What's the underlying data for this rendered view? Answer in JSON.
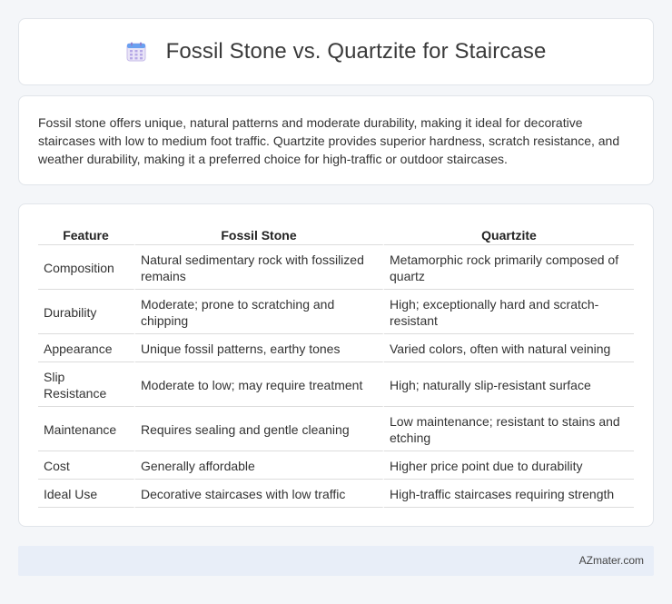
{
  "header": {
    "title": "Fossil Stone vs. Quartzite for Staircase",
    "icon": "calendar-icon"
  },
  "summary": {
    "text": "Fossil stone offers unique, natural patterns and moderate durability, making it ideal for decorative staircases with low to medium foot traffic. Quartzite provides superior hardness, scratch resistance, and weather durability, making it a preferred choice for high-traffic or outdoor staircases."
  },
  "table": {
    "columns": [
      "Feature",
      "Fossil Stone",
      "Quartzite"
    ],
    "rows": [
      [
        "Composition",
        "Natural sedimentary rock with fossilized remains",
        "Metamorphic rock primarily composed of quartz"
      ],
      [
        "Durability",
        "Moderate; prone to scratching and chipping",
        "High; exceptionally hard and scratch-resistant"
      ],
      [
        "Appearance",
        "Unique fossil patterns, earthy tones",
        "Varied colors, often with natural veining"
      ],
      [
        "Slip Resistance",
        "Moderate to low; may require treatment",
        "High; naturally slip-resistant surface"
      ],
      [
        "Maintenance",
        "Requires sealing and gentle cleaning",
        "Low maintenance; resistant to stains and etching"
      ],
      [
        "Cost",
        "Generally affordable",
        "Higher price point due to durability"
      ],
      [
        "Ideal Use",
        "Decorative staircases with low traffic",
        "High-traffic staircases requiring strength"
      ]
    ]
  },
  "footer": {
    "text": "AZmater.com"
  }
}
